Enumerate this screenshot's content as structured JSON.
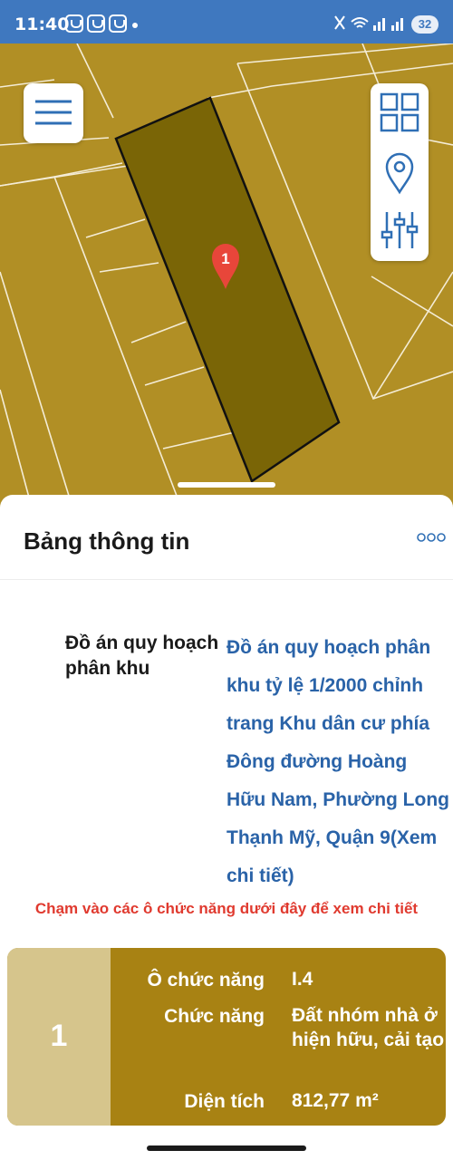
{
  "status_bar": {
    "time": "11:40",
    "battery": "32"
  },
  "map": {
    "marker_label": "1",
    "colors": {
      "land": "#b18f25",
      "parcel": "#7a6506",
      "marker": "#e8463a"
    }
  },
  "info_panel": {
    "title": "Bảng thông tin",
    "plan_label": "Đồ án quy hoạch phân khu",
    "plan_value": "Đồ án quy hoạch phân khu tỷ lệ 1/2000 chỉnh trang Khu dân cư phía Đông đường Hoàng Hữu Nam, Phường Long Thạnh Mỹ, Quận 9(Xem chi tiết)",
    "hint": "Chạm vào các ô chức năng dưới đây để xem chi tiết"
  },
  "function_card": {
    "number": "1",
    "rows": [
      {
        "label": "Ô chức năng",
        "value": "I.4"
      },
      {
        "label": "Chức năng",
        "value": "Đất nhóm nhà ở hiện hữu, cải tạo"
      },
      {
        "label": "Diện tích",
        "value": "812,77 m²"
      }
    ]
  },
  "icons": {
    "menu": "hamburger-icon",
    "layers": "grid-icon",
    "location": "map-pin-icon",
    "filter": "sliders-icon",
    "more": "more-dots-icon"
  }
}
